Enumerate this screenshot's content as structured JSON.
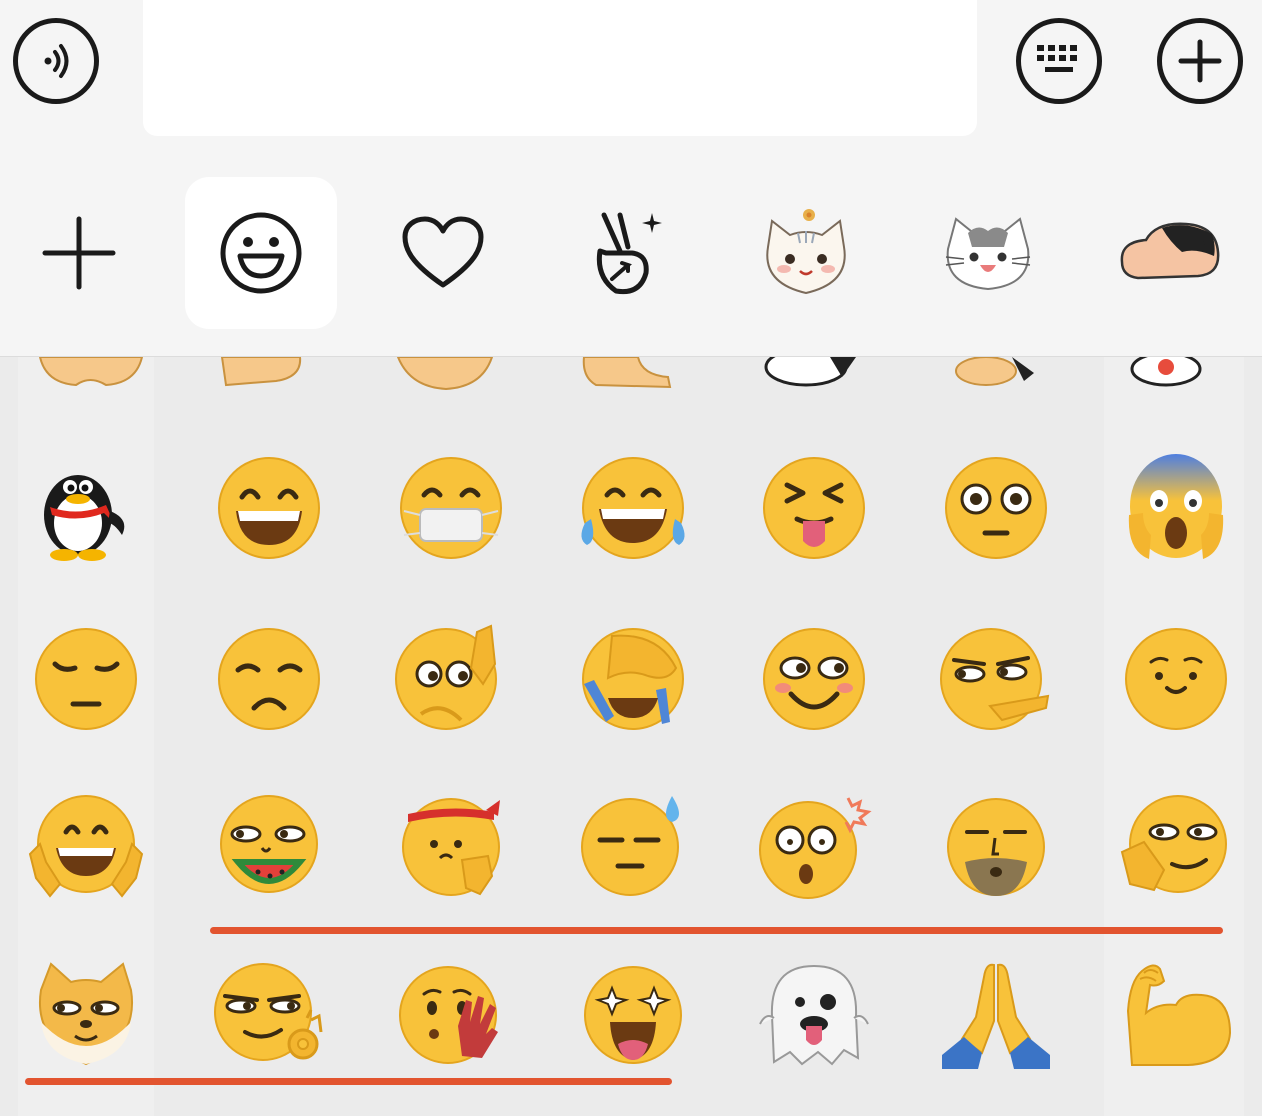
{
  "input_bar": {
    "voice_button": "voice-icon",
    "text_field_value": "",
    "keyboard_button": "keyboard-icon",
    "more_button": "plus-circle-icon"
  },
  "tabs": [
    {
      "name": "add",
      "icon": "plus-icon"
    },
    {
      "name": "emoji",
      "icon": "smiley-icon",
      "active": true
    },
    {
      "name": "favorites",
      "icon": "heart-icon"
    },
    {
      "name": "stickers",
      "icon": "victory-hand-icon"
    },
    {
      "name": "sticker-pack-cat-flower",
      "icon": "cat-sticker-icon"
    },
    {
      "name": "sticker-pack-cat-2",
      "icon": "cat-sticker-icon"
    },
    {
      "name": "sticker-pack-crayon-shinchan",
      "icon": "cartoon-boy-sticker-icon"
    }
  ],
  "emoji_rows": [
    [
      "penguin",
      "grin",
      "mask",
      "tears-of-joy",
      "squint-tongue",
      "flushed",
      "scream"
    ],
    [
      "pensive",
      "unamused",
      "peek",
      "facepalm",
      "smirk-blush",
      "side-eye-point",
      "shy"
    ],
    [
      "peace-hands",
      "watermelon",
      "headband-fist",
      "sweat-expressionless",
      "shocked-pop",
      "whistle-dark",
      "thinking-smirk"
    ],
    [
      "doge",
      "ok-smirk",
      "hand-cover",
      "star-struck",
      "ghost",
      "pray",
      "muscle"
    ]
  ],
  "colors": {
    "accent_underline": "#e2542f",
    "emoji_yellow": "#f8c23a",
    "background": "#ebebeb"
  }
}
